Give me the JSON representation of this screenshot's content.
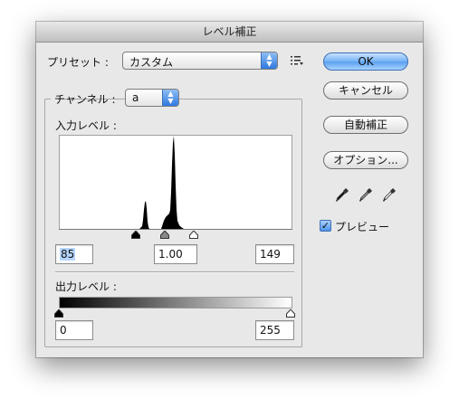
{
  "window": {
    "title": "レベル補正"
  },
  "preset": {
    "label": "プリセット :",
    "value": "カスタム"
  },
  "buttons": {
    "ok": "OK",
    "cancel": "キャンセル",
    "auto": "自動補正",
    "options": "オプション..."
  },
  "channel": {
    "label": "チャンネル :",
    "value": "a"
  },
  "input_levels": {
    "label": "入力レベル :",
    "black": "85",
    "gamma": "1.00",
    "white": "149"
  },
  "output_levels": {
    "label": "出力レベル :",
    "black": "0",
    "white": "255"
  },
  "preview": {
    "label": "プレビュー",
    "checked": true
  },
  "icons": {
    "preset_menu": "preset-options-menu-icon",
    "black_eyedropper": "black-point-eyedropper-icon",
    "gray_eyedropper": "gray-point-eyedropper-icon",
    "white_eyedropper": "white-point-eyedropper-icon"
  },
  "colors": {
    "accent": "#5aa0ef",
    "selection": "#b5d5ff"
  }
}
